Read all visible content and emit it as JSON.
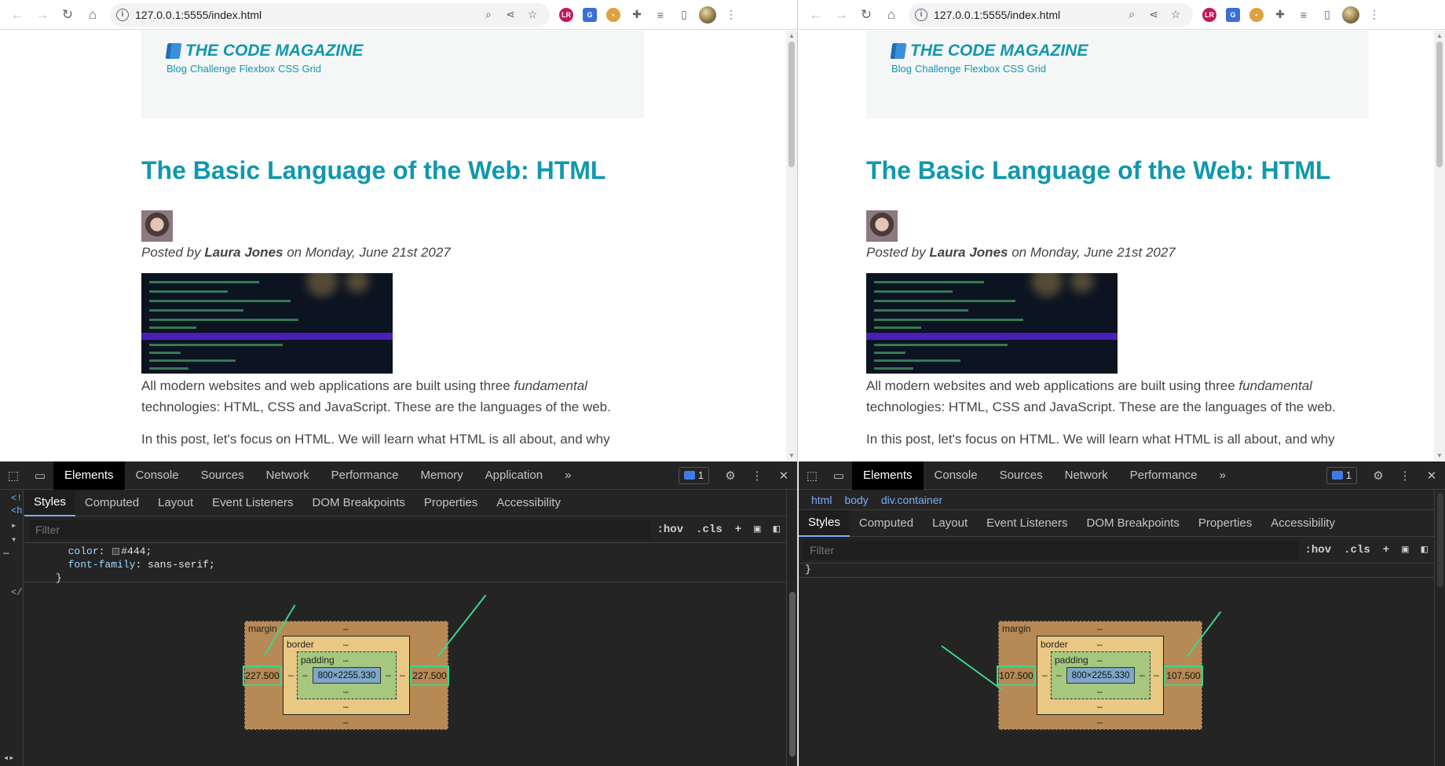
{
  "browser": {
    "url": "127.0.0.1:5555/index.html"
  },
  "page": {
    "brand": "THE CODE MAGAZINE",
    "nav": [
      "Blog",
      "Challenge",
      "Flexbox",
      "CSS Grid"
    ],
    "post_title": "The Basic Language of the Web: HTML",
    "posted_prefix": "Posted by ",
    "author": "Laura Jones",
    "posted_suffix": " on Monday, June 21st 2027",
    "para1_a": "All modern websites and web applications are built using three ",
    "para1_em": "fundamental",
    "para1_b": " technologies: HTML, CSS and JavaScript. These are the languages of the web.",
    "para2": "In this post, let's focus on HTML. We will learn what HTML is all about, and why"
  },
  "devtools": {
    "tabs_left": [
      "Elements",
      "Console",
      "Sources",
      "Network",
      "Performance",
      "Memory",
      "Application"
    ],
    "tabs_right": [
      "Elements",
      "Console",
      "Sources",
      "Network",
      "Performance"
    ],
    "more": "»",
    "issues_count": "1",
    "subtabs": [
      "Styles",
      "Computed",
      "Layout",
      "Event Listeners",
      "DOM Breakpoints",
      "Properties",
      "Accessibility"
    ],
    "filter_placeholder": "Filter",
    "hov": ":hov",
    "cls": ".cls",
    "breadcrumbs": [
      "html",
      "body",
      "div.container"
    ],
    "css_color_prop": "color",
    "css_color_val": "#444;",
    "css_font_prop": "font-family",
    "css_font_val": "sans-serif;",
    "css_close": "}",
    "gutter_left": [
      "<!",
      "<h",
      "▸",
      "▾",
      "</"
    ],
    "left_box": {
      "margin_label": "margin",
      "border_label": "border",
      "padding_label": "padding",
      "content": "800×2255.330",
      "margin_left": "227.500",
      "margin_right": "227.500",
      "dash": "–"
    },
    "right_box": {
      "margin_label": "margin",
      "border_label": "border",
      "padding_label": "padding",
      "content": "800×2255.330",
      "margin_left": "107.500",
      "margin_right": "107.500",
      "dash": "–"
    }
  },
  "colors": {
    "accent": "#1098ad",
    "text": "#444444",
    "devtools_bg": "#242424",
    "highlight_green": "#3dd68c"
  }
}
